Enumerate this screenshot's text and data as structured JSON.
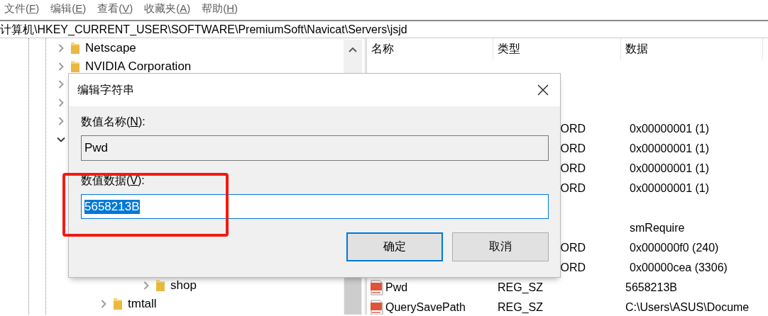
{
  "menu": [
    {
      "label": "文件(",
      "access_key": "F",
      "label_end": ")"
    },
    {
      "label": "编辑(",
      "access_key": "E",
      "label_end": ")"
    },
    {
      "label": "查看(",
      "access_key": "V",
      "label_end": ")"
    },
    {
      "label": "收藏夹(",
      "access_key": "A",
      "label_end": ")"
    },
    {
      "label": "帮助(",
      "access_key": "H",
      "label_end": ")"
    }
  ],
  "address": "计算机\\HKEY_CURRENT_USER\\SOFTWARE\\PremiumSoft\\Navicat\\Servers\\jsjd",
  "tree": [
    {
      "name": "Netscape",
      "expanded": false
    },
    {
      "name": "NVIDIA Corporation",
      "expanded": false
    },
    {
      "expanded": false
    },
    {
      "expanded": false
    },
    {
      "expanded": false
    },
    {
      "expanded": true,
      "children": [
        {
          "children": [
            {
              "name": "shop",
              "expanded": false
            }
          ]
        },
        {
          "name": "tmtall",
          "expanded": false
        }
      ]
    }
  ],
  "list": {
    "columns": [
      "名称",
      "类型",
      "数据"
    ],
    "rows": [
      {
        "kind": "covered"
      },
      {
        "kind": "covered"
      },
      {
        "kind": "covered"
      },
      {
        "kind": "cut",
        "type": "ORD",
        "data": "0x00000001 (1)"
      },
      {
        "kind": "cut",
        "type": "ORD",
        "data": "0x00000001 (1)"
      },
      {
        "kind": "cut",
        "type": "ORD",
        "data": "0x00000001 (1)"
      },
      {
        "kind": "cut",
        "type": "ORD",
        "data": "0x00000001 (1)"
      },
      {
        "kind": "covered"
      },
      {
        "kind": "cut",
        "data": "smRequire"
      },
      {
        "kind": "cut",
        "type": "ORD",
        "data": "0x000000f0 (240)"
      },
      {
        "kind": "cut",
        "type": "ORD",
        "data": "0x00000cea (3306)"
      },
      {
        "kind": "string",
        "name": "Pwd",
        "type": "REG_SZ",
        "data": "5658213B"
      },
      {
        "kind": "string",
        "name": "QuerySavePath",
        "type": "REG_SZ",
        "data": "C:\\Users\\ASUS\\Docume"
      }
    ]
  },
  "dialog": {
    "title": "编辑字符串",
    "name_label": {
      "text": "数值名称(",
      "access_key": "N",
      "text_end": "):"
    },
    "name_value": "Pwd",
    "name_readonly": true,
    "data_label": {
      "text": "数值数据(",
      "access_key": "V",
      "text_end": "):"
    },
    "data_value": "5658213B",
    "data_selected": true,
    "buttons": [
      {
        "label": "确定",
        "default": true
      },
      {
        "label": "取消",
        "default": false
      }
    ],
    "annotation_box": true
  }
}
